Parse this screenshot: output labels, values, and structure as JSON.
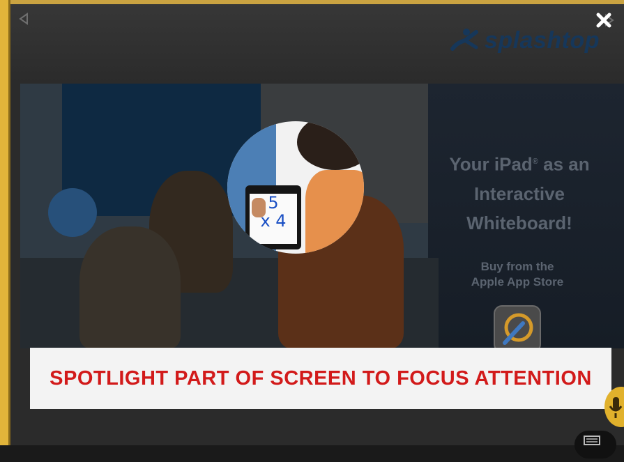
{
  "app": {
    "brand": "splashtop",
    "close_label": "✕"
  },
  "slide": {
    "tagline": [
      "Your iPad",
      " as an",
      "Interactive",
      "Whiteboard!"
    ],
    "tagline_reg": "®",
    "store_line1": "Buy from the",
    "store_line2": "Apple App Store",
    "ipad_math": [
      "5",
      "x 4"
    ]
  },
  "caption": {
    "text": "SPOTLIGHT PART OF SCREEN TO FOCUS ATTENTION"
  },
  "colors": {
    "accent_gold": "#e1b43a",
    "caption_red": "#d21a1a",
    "brand_blue": "#16375a"
  },
  "icons": {
    "prev": "chevron-left-icon",
    "next": "chevron-right-icon",
    "close": "close-icon",
    "logo": "splashtop-logo-icon",
    "mic": "microphone-icon",
    "keyboard": "keyboard-icon"
  }
}
